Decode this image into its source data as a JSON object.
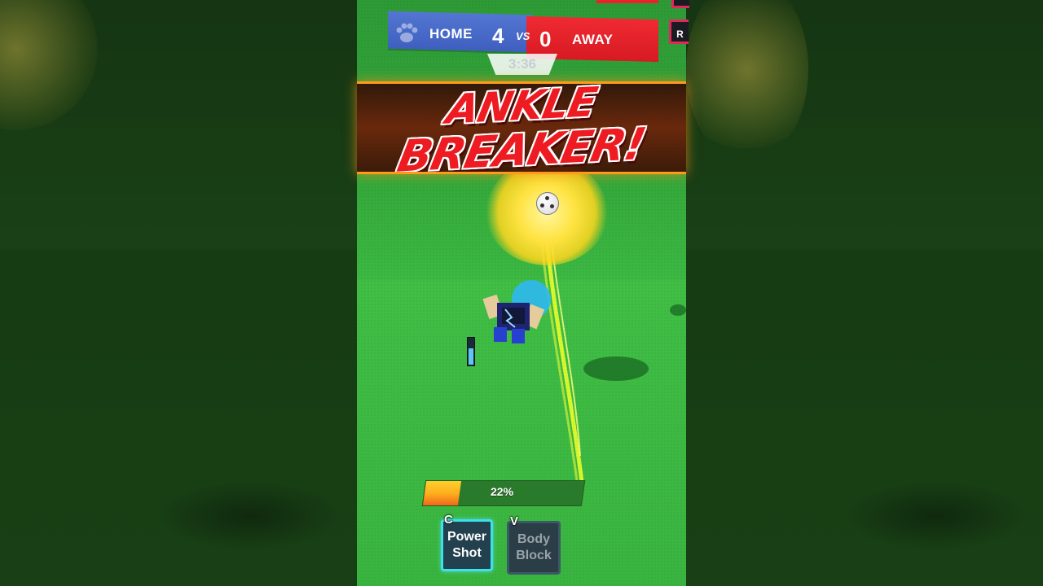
{
  "scoreboard": {
    "home_label": "HOME",
    "home_score": "4",
    "vs": "VS",
    "away_score": "0",
    "away_label": "AWAY",
    "timer": "3:36",
    "corner_button": "R"
  },
  "banner": {
    "line1": "ANKLE",
    "line2": "BREAKER!"
  },
  "charge": {
    "label": "22%",
    "fraction": 0.22
  },
  "abilities": [
    {
      "key": "C",
      "label": "Power Shot",
      "state": "active"
    },
    {
      "key": "V",
      "label": "Body Block",
      "state": "disabled"
    }
  ],
  "stamina": {
    "fraction": 0.6
  },
  "colors": {
    "home": "#4a6bc8",
    "away": "#e4212a",
    "banner_text": "#ee1c22",
    "pitch": "#3cb843",
    "active_ability_border": "#3ee0ee"
  },
  "icons": [
    "paw-icon",
    "soccer-ball-icon",
    "player-avatar"
  ]
}
